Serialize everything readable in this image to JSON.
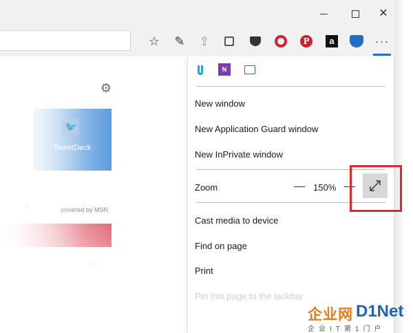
{
  "window": {
    "close_glyph": "✕"
  },
  "toolbar": {
    "icons": [
      "favorites-icon",
      "pen-icon",
      "share-icon",
      "lock-icon",
      "pocket-icon",
      "opera-icon",
      "pinterest-icon",
      "amazon-icon",
      "extension-icon",
      "more-icon"
    ],
    "favorites_glyph": "☆",
    "pen_glyph": "✎",
    "share_glyph": "⇪",
    "pinterest_glyph": "P",
    "amazon_glyph": "a",
    "more_glyph": "···"
  },
  "page": {
    "tile_label": "TweetDeck",
    "tile_icon_glyph": "🐦",
    "powered_by": "powered by MSN",
    "gear_glyph": "⚙",
    "more_glyph": "···"
  },
  "menu": {
    "top_icons": [
      "save-to-cloud-icon",
      "onenote-icon",
      "web-note-icon"
    ],
    "onenote_glyph": "N",
    "items_group1": [
      "New window",
      "New Application Guard window",
      "New InPrivate window"
    ],
    "zoom": {
      "label": "Zoom",
      "value": "150%"
    },
    "items_group2": [
      "Cast media to device",
      "Find on page",
      "Print",
      "Pin this page to the taskbar"
    ]
  },
  "watermark": {
    "brand_cn": "企业网",
    "brand_en": "D1Net",
    "tagline": "企业IT第1门户"
  },
  "colors": {
    "accent": "#1f6fc4",
    "highlight_box": "#e4262b",
    "tile": "#5d9be0"
  }
}
